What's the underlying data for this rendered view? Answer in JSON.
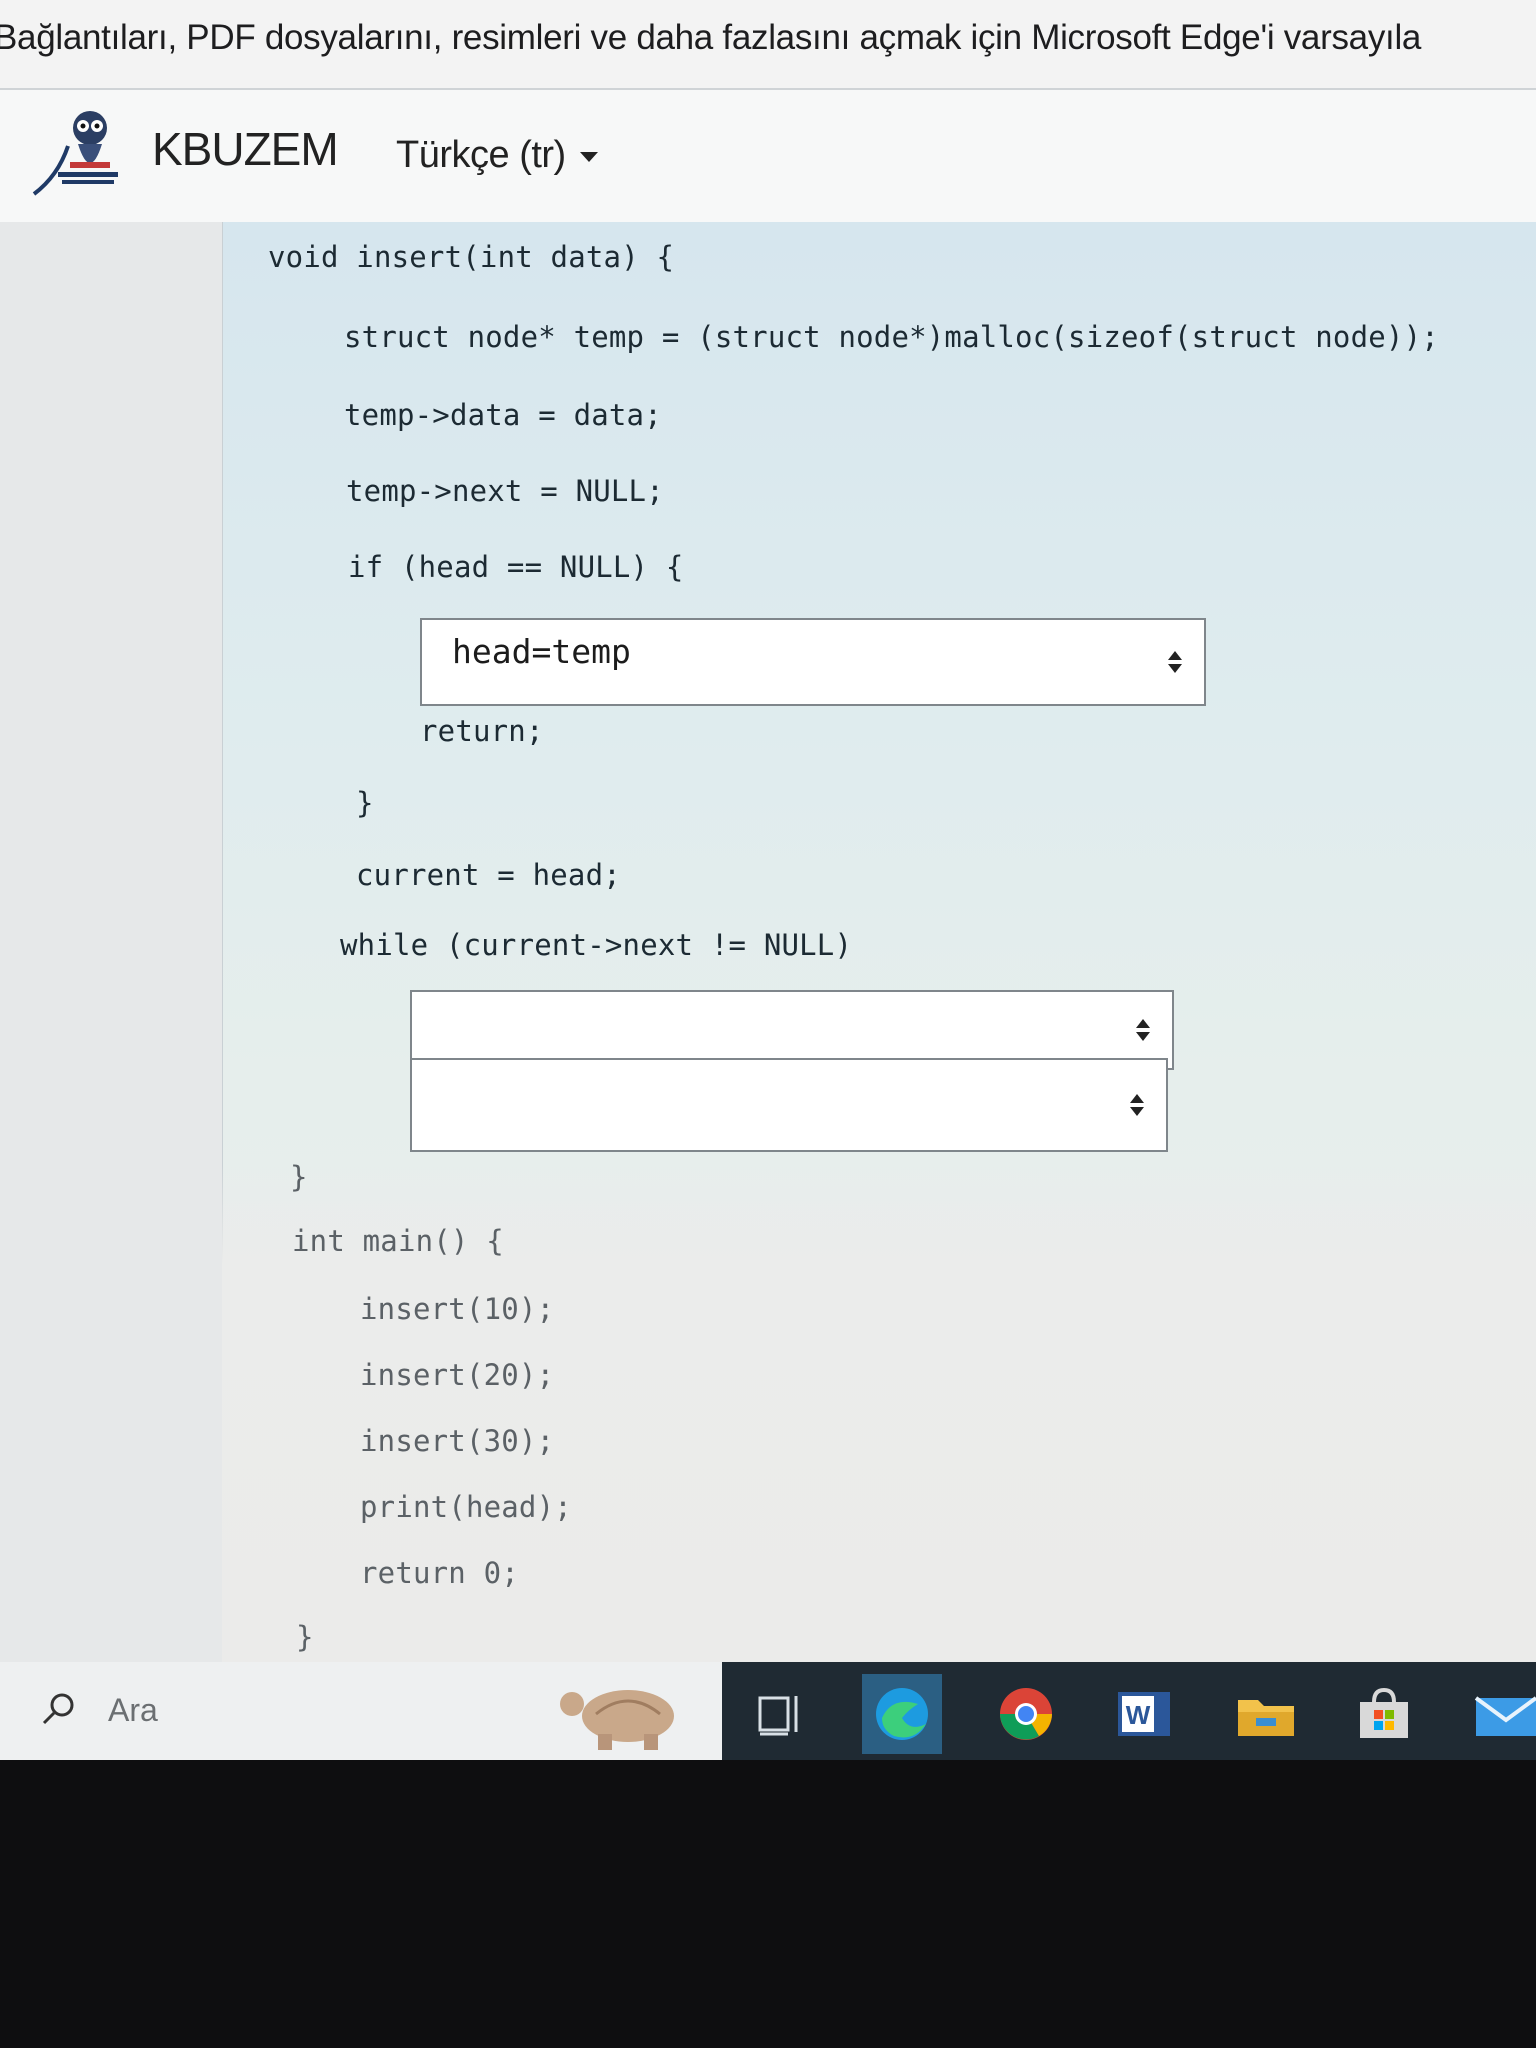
{
  "edge_notification": {
    "text": "Bağlantıları, PDF dosyalarını, resimleri ve daha fazlasını açmak için Microsoft Edge'i varsayıla"
  },
  "header": {
    "site_name": "KBUZEM",
    "language": "Türkçe (tr)",
    "logo_icon": "owl-logo"
  },
  "code": {
    "func_sig": "void insert(int data) {",
    "line_malloc": "struct node* temp = (struct node*)malloc(sizeof(struct node));",
    "line_data": "temp->data = data;",
    "line_next": "temp->next = NULL;",
    "line_if": "if (head == NULL) {",
    "line_return": "return;",
    "line_close_if": "}",
    "line_current": "current = head;",
    "line_while": "while (current->next != NULL)",
    "line_close_func": "}",
    "main_sig": "int main() {",
    "main_lines": [
      "insert(10);",
      "insert(20);",
      "insert(30);",
      "print(head);",
      "return 0;"
    ],
    "main_close": "}"
  },
  "dropdowns": {
    "first_selected": "head=temp",
    "second_selected": "",
    "third_selected": ""
  },
  "taskbar": {
    "search_placeholder": "Ara",
    "icons": [
      "search-icon",
      "task-view-icon",
      "edge-icon",
      "chrome-icon",
      "word-icon",
      "file-explorer-icon",
      "store-icon",
      "mail-icon"
    ]
  }
}
